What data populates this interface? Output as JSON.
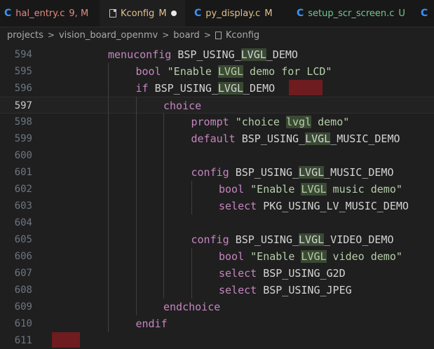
{
  "tabs": [
    {
      "icon": "C",
      "name": "hal_entry.c",
      "status": "9, M",
      "color": "#f48771",
      "status_type": "error"
    },
    {
      "icon": "file",
      "name": "Kconfig",
      "status": "M",
      "color": "#e2c08d",
      "status_type": "modified"
    },
    {
      "icon": "C",
      "name": "py_display.c",
      "status": "M",
      "color": "#e2c08d",
      "status_type": "modified"
    },
    {
      "icon": "C",
      "name": "setup_scr_screen.c",
      "status": "U",
      "color": "#73c991",
      "status_type": "untracked"
    },
    {
      "icon": "C",
      "name": "",
      "status": "",
      "color": "#3794ff",
      "status_type": "none"
    }
  ],
  "breadcrumb": [
    "projects",
    "vision_board_openmv",
    "board",
    "Kconfig"
  ],
  "lines": [
    {
      "n": "594",
      "indent": 2,
      "parts": [
        {
          "t": "menuconfig",
          "c": "kw"
        },
        {
          "t": " BSP_USING_",
          "c": "ident"
        },
        {
          "t": "LVGL",
          "c": "ident hl"
        },
        {
          "t": "_DEMO",
          "c": "ident"
        }
      ]
    },
    {
      "n": "595",
      "indent": 3,
      "parts": [
        {
          "t": "bool",
          "c": "kw"
        },
        {
          "t": " ",
          "c": ""
        },
        {
          "t": "\"Enable ",
          "c": "strg"
        },
        {
          "t": "LVGL",
          "c": "strg hl"
        },
        {
          "t": " demo for LCD\"",
          "c": "strg"
        }
      ]
    },
    {
      "n": "596",
      "indent": 3,
      "parts": [
        {
          "t": "if",
          "c": "kw"
        },
        {
          "t": " BSP_USING_",
          "c": "ident"
        },
        {
          "t": "LVGL",
          "c": "ident hl"
        },
        {
          "t": "_DEMO",
          "c": "ident"
        }
      ]
    },
    {
      "n": "597",
      "indent": 4,
      "parts": [
        {
          "t": "choice",
          "c": "kw"
        }
      ]
    },
    {
      "n": "598",
      "indent": 5,
      "parts": [
        {
          "t": "prompt",
          "c": "kw"
        },
        {
          "t": " ",
          "c": ""
        },
        {
          "t": "\"choice ",
          "c": "strg"
        },
        {
          "t": "lvgl",
          "c": "strg hl"
        },
        {
          "t": " demo\"",
          "c": "strg"
        }
      ]
    },
    {
      "n": "599",
      "indent": 5,
      "parts": [
        {
          "t": "default",
          "c": "kw"
        },
        {
          "t": " BSP_USING_",
          "c": "ident"
        },
        {
          "t": "LVGL",
          "c": "ident hl"
        },
        {
          "t": "_MUSIC_DEMO",
          "c": "ident"
        }
      ]
    },
    {
      "n": "600",
      "indent": 0,
      "parts": []
    },
    {
      "n": "601",
      "indent": 5,
      "parts": [
        {
          "t": "config",
          "c": "kw"
        },
        {
          "t": " BSP_USING_",
          "c": "ident"
        },
        {
          "t": "LVGL",
          "c": "ident hl"
        },
        {
          "t": "_MUSIC_DEMO",
          "c": "ident"
        }
      ]
    },
    {
      "n": "602",
      "indent": 6,
      "parts": [
        {
          "t": "bool",
          "c": "kw"
        },
        {
          "t": " ",
          "c": ""
        },
        {
          "t": "\"Enable ",
          "c": "strg"
        },
        {
          "t": "LVGL",
          "c": "strg hl"
        },
        {
          "t": " music demo\"",
          "c": "strg"
        }
      ]
    },
    {
      "n": "603",
      "indent": 6,
      "parts": [
        {
          "t": "select",
          "c": "kw"
        },
        {
          "t": " PKG_USING_LV_MUSIC_DEMO",
          "c": "ident"
        }
      ]
    },
    {
      "n": "604",
      "indent": 0,
      "parts": []
    },
    {
      "n": "605",
      "indent": 5,
      "parts": [
        {
          "t": "config",
          "c": "kw"
        },
        {
          "t": " BSP_USING_",
          "c": "ident"
        },
        {
          "t": "LVGL",
          "c": "ident hl"
        },
        {
          "t": "_VIDEO_DEMO",
          "c": "ident"
        }
      ]
    },
    {
      "n": "606",
      "indent": 6,
      "parts": [
        {
          "t": "bool",
          "c": "kw"
        },
        {
          "t": " ",
          "c": ""
        },
        {
          "t": "\"Enable ",
          "c": "strg"
        },
        {
          "t": "LVGL",
          "c": "strg hl"
        },
        {
          "t": " video demo\"",
          "c": "strg"
        }
      ]
    },
    {
      "n": "607",
      "indent": 6,
      "parts": [
        {
          "t": "select",
          "c": "kw"
        },
        {
          "t": " BSP_USING_G2D",
          "c": "ident"
        }
      ]
    },
    {
      "n": "608",
      "indent": 6,
      "parts": [
        {
          "t": "select",
          "c": "kw"
        },
        {
          "t": " BSP_USING_JPEG",
          "c": "ident"
        }
      ]
    },
    {
      "n": "609",
      "indent": 4,
      "parts": [
        {
          "t": "endchoice",
          "c": "kw"
        }
      ]
    },
    {
      "n": "610",
      "indent": 3,
      "parts": [
        {
          "t": "endif",
          "c": "kw"
        }
      ]
    },
    {
      "n": "611",
      "indent": 0,
      "parts": []
    }
  ],
  "current_line": "597",
  "colors": {
    "error_highlight": "#6e1c1f",
    "accent": "#3794ff"
  }
}
